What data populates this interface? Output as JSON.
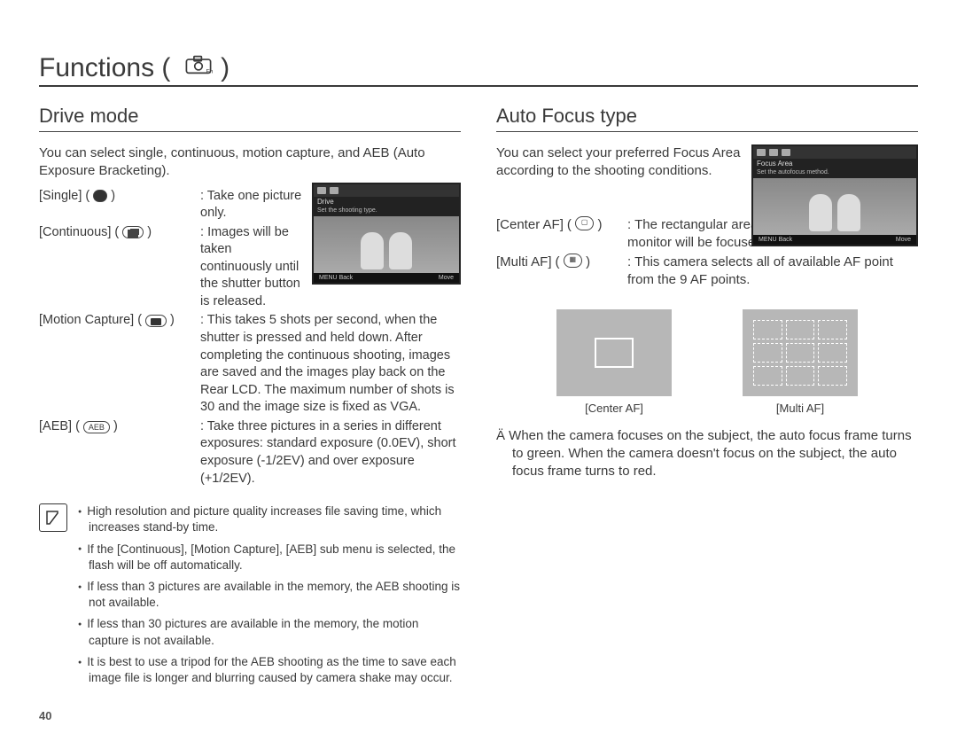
{
  "page_title": "Functions (",
  "page_title_close": ")",
  "page_number": "40",
  "left": {
    "heading": "Drive mode",
    "intro": "You can select single, continuous, motion capture, and AEB (Auto Exposure Bracketing).",
    "modes": [
      {
        "label": "[Single]",
        "icon_name": "single-icon",
        "desc": "Take one picture only."
      },
      {
        "label": "[Continuous]",
        "icon_name": "continuous-icon",
        "desc": "Images will be taken continuously until the shutter button is released."
      },
      {
        "label": "[Motion Capture]",
        "icon_name": "motion-capture-icon",
        "desc": "This takes 5 shots per second, when the shutter is pressed and held down. After completing the continuous shooting, images are saved and the images play back on the Rear LCD. The maximum number of shots is 30 and the image size is fixed as VGA."
      },
      {
        "label": "[AEB]",
        "icon_name": "aeb-icon",
        "desc": "Take three pictures in a series in different exposures: standard exposure (0.0EV), short exposure (-1/2EV) and over exposure (+1/2EV)."
      }
    ],
    "screenshot": {
      "title": "Drive",
      "subtitle": "Set the shooting type.",
      "back": "Back",
      "move": "Move",
      "menu": "MENU"
    },
    "notes": [
      "High resolution and picture quality increases file saving time, which increases stand-by time.",
      "If the [Continuous], [Motion Capture], [AEB] sub menu is selected, the flash will be off automatically.",
      "If less than 3 pictures are available in the memory, the AEB shooting is not available.",
      "If less than 30 pictures are available in the memory, the motion capture is not available.",
      "It is best to use a tripod for the AEB shooting as the time to save each image file is longer and blurring caused by camera shake may occur."
    ]
  },
  "right": {
    "heading": "Auto Focus type",
    "intro": "You can select your preferred Focus Area according to the shooting conditions.",
    "screenshot": {
      "title": "Focus Area",
      "subtitle": "Set the autofocus method.",
      "back": "Back",
      "move": "Move",
      "menu": "MENU"
    },
    "af_modes": [
      {
        "label": "[Center AF]",
        "icon_name": "center-af-icon",
        "desc": "The rectangular area in the center of the LCD monitor will be focused"
      },
      {
        "label": "[Multi AF]",
        "icon_name": "multi-af-icon",
        "desc": "This camera selects all of available AF point from the 9 AF points."
      }
    ],
    "diagram_labels": {
      "center": "[Center AF]",
      "multi": "[Multi AF]"
    },
    "footnote": "Ä When the camera focuses on the subject, the auto focus frame turns to green. When the camera doesn't focus on the subject, the auto focus frame turns to red."
  }
}
